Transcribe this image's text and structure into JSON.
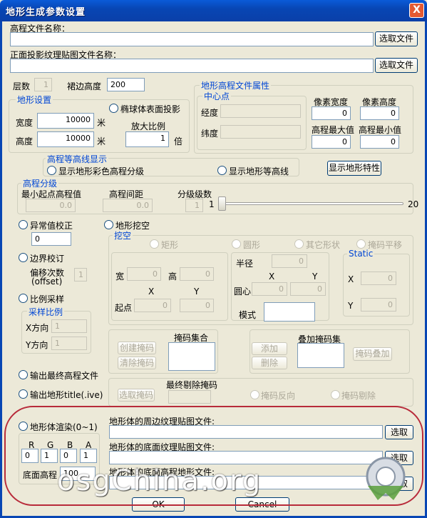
{
  "window": {
    "title": "地形生成参数设置",
    "close": "X"
  },
  "elev": {
    "label": "高程文件名称：",
    "value": "",
    "button": "选取文件"
  },
  "tex": {
    "label": "正面投影纹理贴图文件名称：",
    "value": "",
    "button": "选取文件"
  },
  "layers": {
    "label": "层数",
    "value": "1"
  },
  "skirt": {
    "label": "裙边高度",
    "value": "200"
  },
  "terrain": {
    "title": "地形设置",
    "width_label": "宽度",
    "width_value": "10000",
    "unit1": "米",
    "height_label": "高度",
    "height_value": "10000",
    "unit2": "米",
    "ellipsoid_label": "椭球体表面投影",
    "scale_label": "放大比例",
    "scale_value": "1",
    "scale_unit": "倍"
  },
  "props": {
    "title": "地形高程文件属性",
    "center_title": "中心点",
    "lon_label": "经度",
    "lat_label": "纬度",
    "pw_label": "像素宽度",
    "pw_value": "0",
    "ph_label": "像素高度",
    "ph_value": "0",
    "max_label": "高程最大值",
    "max_value": "0",
    "min_label": "高程最小值",
    "min_value": "0"
  },
  "contour": {
    "title": "高程等高线显示",
    "opt1": "显示地形彩色高程分级",
    "opt2": "显示地形等高线",
    "button": "显示地形特性"
  },
  "grading": {
    "title": "高程分级",
    "min_label": "最小起点高程值",
    "min_value": "0.0",
    "interval_label": "高程间距",
    "interval_value": "0.0",
    "levels_label": "分级级数",
    "levels_value": "1",
    "slider_min": "1",
    "slider_max": "20"
  },
  "anomaly": {
    "label": "异常值校正",
    "value": "0"
  },
  "border": {
    "label": "边界校订",
    "offset_label": "偏移次数",
    "offset_sub": "(offset)",
    "offset_value": "1"
  },
  "sampling": {
    "label": "比例采样",
    "group": "采样比例",
    "x_label": "X方向",
    "x_value": "1",
    "y_label": "Y方向",
    "y_value": "1"
  },
  "output_elev": {
    "label": "输出最终高程文件"
  },
  "output_title": {
    "label": "输出地形title(.ive)"
  },
  "dig": {
    "label": "地形挖空",
    "group": "挖空",
    "rect": "矩形",
    "circle": "圆形",
    "other": "其它形状",
    "mask_pan": "掩码平移",
    "width_label": "宽",
    "width_value": "0",
    "height_label": "高",
    "height_value": "0",
    "x": "X",
    "y": "Y",
    "start_label": "起点",
    "start_x": "0",
    "start_y": "0",
    "radius_label": "半径",
    "radius_value": "0",
    "cx": "X",
    "cy": "Y",
    "center_label": "圆心",
    "center_x": "0",
    "center_y": "0",
    "mode_label": "模式",
    "static_title": "Static",
    "sx_label": "X",
    "sx_value": "0",
    "sy_label": "Y",
    "sy_value": "0"
  },
  "maskset": {
    "title": "掩码集合",
    "create": "创建掩码",
    "clear": "清除掩码"
  },
  "overlay": {
    "title": "叠加掩码集",
    "add": "添加",
    "del": "删除",
    "overlay_btn": "掩码叠加"
  },
  "final": {
    "title": "最终剔除掩码",
    "pick": "选取掩码",
    "reverse": "掩码反向",
    "remove": "掩码剔除"
  },
  "render": {
    "label": "地形体渲染(0~1)",
    "r": "R",
    "g": "G",
    "b": "B",
    "a": "A",
    "r_value": "0",
    "g_value": "1",
    "b_value": "0",
    "a_value": "1",
    "base_label": "底面高程",
    "base_value": "100"
  },
  "around": {
    "label": "地形体的周边纹理贴图文件:",
    "button": "选取"
  },
  "bottom_tex": {
    "label": "地形体的底面纹理贴图文件:",
    "button": "选取"
  },
  "bottom_elev": {
    "label": "地形体的底面高程地形文件:",
    "button": "选取"
  },
  "footer": {
    "ok": "OK",
    "cancel": "Cancel"
  },
  "watermark": "osgChina.org"
}
